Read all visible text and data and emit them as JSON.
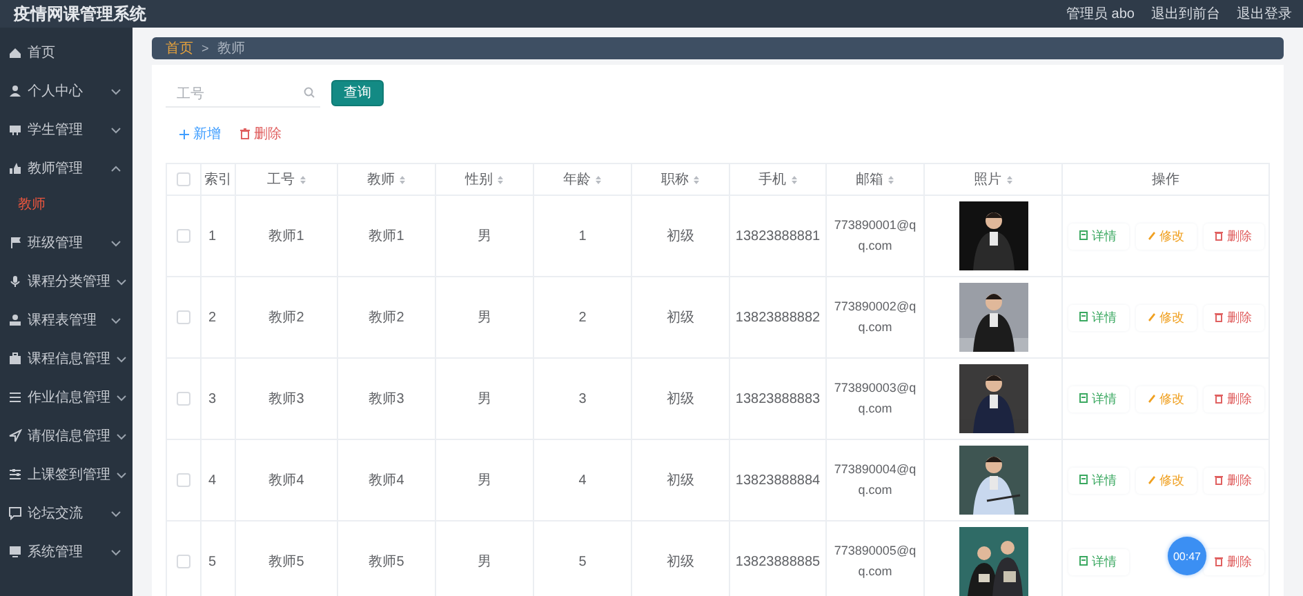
{
  "header": {
    "title": "疫情网课管理系统",
    "links": [
      "管理员 abo",
      "退出到前台",
      "退出登录"
    ]
  },
  "sidebar": {
    "items": [
      {
        "kind": "link",
        "label": "首页"
      },
      {
        "kind": "menu",
        "label": "个人中心",
        "expanded": false
      },
      {
        "kind": "menu",
        "label": "学生管理",
        "expanded": false
      },
      {
        "kind": "menu",
        "label": "教师管理",
        "expanded": true,
        "children": [
          {
            "label": "教师",
            "selected": true
          }
        ]
      },
      {
        "kind": "menu",
        "label": "班级管理",
        "expanded": false
      },
      {
        "kind": "menu",
        "label": "课程分类管理",
        "expanded": false
      },
      {
        "kind": "menu",
        "label": "课程表管理",
        "expanded": false
      },
      {
        "kind": "menu",
        "label": "课程信息管理",
        "expanded": false
      },
      {
        "kind": "menu",
        "label": "作业信息管理",
        "expanded": false
      },
      {
        "kind": "menu",
        "label": "请假信息管理",
        "expanded": false
      },
      {
        "kind": "menu",
        "label": "上课签到管理",
        "expanded": false
      },
      {
        "kind": "menu",
        "label": "论坛交流",
        "expanded": false
      },
      {
        "kind": "menu",
        "label": "系统管理",
        "expanded": false
      }
    ]
  },
  "breadcrumb": [
    {
      "label": "首页",
      "selected": false
    },
    {
      "label": "教师",
      "selected": true
    }
  ],
  "breadcrumb_separator": ">",
  "search": {
    "placeholder": "工号",
    "button": "查询"
  },
  "toolbar": [
    {
      "kind": "add",
      "label": "新增"
    },
    {
      "kind": "delete",
      "label": "删除"
    }
  ],
  "table": {
    "select_all": {
      "checked": false
    },
    "columns": [
      {
        "kind": "checkbox",
        "sortable": false
      },
      {
        "label": "索引",
        "sortable": false
      },
      {
        "label": "工号",
        "sortable": true
      },
      {
        "label": "教师",
        "sortable": true
      },
      {
        "label": "性别",
        "sortable": true
      },
      {
        "label": "年龄",
        "sortable": true
      },
      {
        "label": "职称",
        "sortable": true
      },
      {
        "label": "手机",
        "sortable": true
      },
      {
        "label": "邮箱",
        "sortable": true
      },
      {
        "label": "照片",
        "sortable": true
      },
      {
        "label": "操作",
        "sortable": false
      }
    ],
    "rows": [
      {
        "checked": false,
        "index": "1",
        "id": "教师1",
        "teacher": "教师1",
        "gender": "男",
        "age": "1",
        "title": "初级",
        "phone": "13823888881",
        "email": "773890001@qq.com",
        "photo": {
          "kind": "picture"
        },
        "actions": [
          {
            "kind": "detail",
            "label": "详情"
          },
          {
            "kind": "edit",
            "label": "修改"
          },
          {
            "kind": "delete",
            "label": "删除"
          }
        ]
      },
      {
        "checked": false,
        "index": "2",
        "id": "教师2",
        "teacher": "教师2",
        "gender": "男",
        "age": "2",
        "title": "初级",
        "phone": "13823888882",
        "email": "773890002@qq.com",
        "photo": {
          "kind": "picture"
        },
        "actions": [
          {
            "kind": "detail",
            "label": "详情"
          },
          {
            "kind": "edit",
            "label": "修改"
          },
          {
            "kind": "delete",
            "label": "删除"
          }
        ]
      },
      {
        "checked": false,
        "index": "3",
        "id": "教师3",
        "teacher": "教师3",
        "gender": "男",
        "age": "3",
        "title": "初级",
        "phone": "13823888883",
        "email": "773890003@qq.com",
        "photo": {
          "kind": "picture"
        },
        "actions": [
          {
            "kind": "detail",
            "label": "详情"
          },
          {
            "kind": "edit",
            "label": "修改"
          },
          {
            "kind": "delete",
            "label": "删除"
          }
        ]
      },
      {
        "checked": false,
        "index": "4",
        "id": "教师4",
        "teacher": "教师4",
        "gender": "男",
        "age": "4",
        "title": "初级",
        "phone": "13823888884",
        "email": "773890004@qq.com",
        "photo": {
          "kind": "picture"
        },
        "actions": [
          {
            "kind": "detail",
            "label": "详情"
          },
          {
            "kind": "edit",
            "label": "修改"
          },
          {
            "kind": "delete",
            "label": "删除"
          }
        ]
      },
      {
        "checked": false,
        "index": "5",
        "id": "教师5",
        "teacher": "教师5",
        "gender": "男",
        "age": "5",
        "title": "初级",
        "phone": "13823888885",
        "email": "773890005@qq.com",
        "photo": {
          "kind": "picture"
        },
        "actions": [
          {
            "kind": "detail",
            "label": "详情"
          },
          {
            "kind": "delete",
            "label": "删除"
          }
        ]
      }
    ]
  },
  "recording_timer": {
    "text": "00:47"
  }
}
